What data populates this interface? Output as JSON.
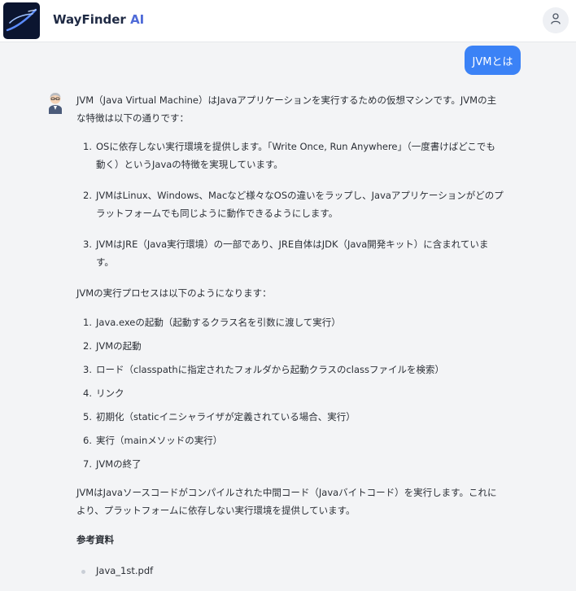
{
  "app": {
    "title_main": "WayFinder",
    "title_accent": "AI"
  },
  "header": {
    "user_icon": "user-icon",
    "logo_icon": "wayfinder-logo"
  },
  "chat": {
    "user_message": "JVMとは",
    "assistant_avatar": "assistant-avatar-icon",
    "answer": {
      "intro": "JVM（Java Virtual Machine）はJavaアプリケーションを実行するための仮想マシンです。JVMの主な特徴は以下の通りです：",
      "features": [
        {
          "num": "1.",
          "text": "OSに依存しない実行環境を提供します。「Write Once, Run Anywhere」（一度書けばどこでも動く）というJavaの特徴を実現しています。"
        },
        {
          "num": "2.",
          "text": "JVMはLinux、Windows、Macなど様々なOSの違いをラップし、Javaアプリケーションがどのプラットフォームでも同じように動作できるようにします。"
        },
        {
          "num": "3.",
          "text": "JVMはJRE（Java実行環境）の一部であり、JRE自体はJDK（Java開発キット）に含まれています。"
        }
      ],
      "process_intro": "JVMの実行プロセスは以下のようになります：",
      "steps": [
        {
          "num": "1.",
          "text": "Java.exeの起動（起動するクラス名を引数に渡して実行）"
        },
        {
          "num": "2.",
          "text": "JVMの起動"
        },
        {
          "num": "3.",
          "text": "ロード（classpathに指定されたフォルダから起動クラスのclassファイルを検索）"
        },
        {
          "num": "4.",
          "text": "リンク"
        },
        {
          "num": "5.",
          "text": "初期化（staticイニシャライザが定義されている場合、実行）"
        },
        {
          "num": "6.",
          "text": "実行（mainメソッドの実行）"
        },
        {
          "num": "7.",
          "text": "JVMの終了"
        }
      ],
      "summary": "JVMはJavaソースコードがコンパイルされた中間コード（Javaバイトコード）を実行します。これにより、プラットフォームに依存しない実行環境を提供しています。",
      "references_title": "参考資料",
      "references": [
        "Java_1st.pdf"
      ]
    }
  }
}
